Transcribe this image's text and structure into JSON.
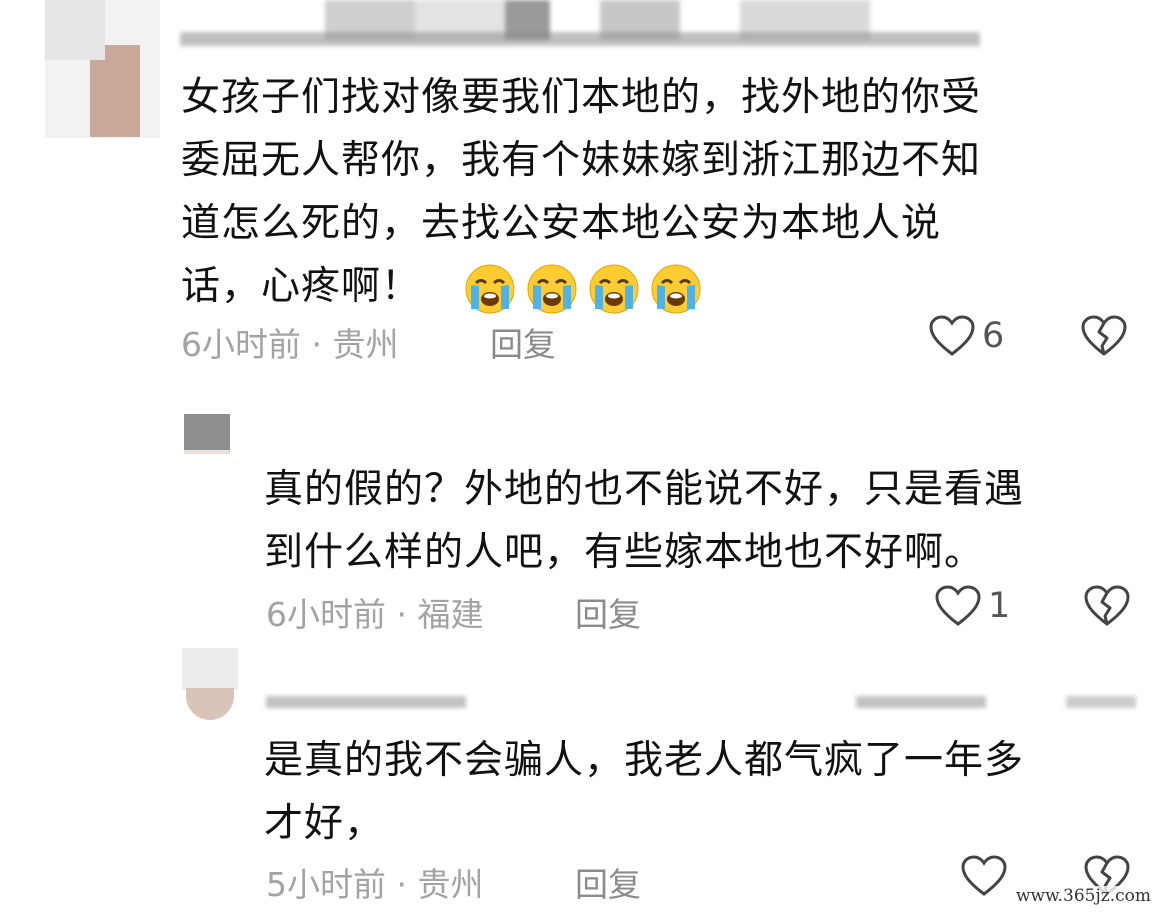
{
  "comments": [
    {
      "text_lines": [
        "女孩子们找对像要我们本地的，找外地的你受",
        "委屈无人帮你，我有个妹妹嫁到浙江那边不知",
        "道怎么死的，去找公安本地公安为本地人说"
      ],
      "last_line_text": "话，心疼啊！",
      "emoji_icon": "loudly-crying-face-icon",
      "emoji_count": 4,
      "meta": "6小时前 · 贵州",
      "reply_label": "回复",
      "like_count": "6"
    },
    {
      "text_lines": [
        "真的假的？外地的也不能说不好，只是看遇",
        "到什么样的人吧，有些嫁本地也不好啊。"
      ],
      "meta": "6小时前 · 福建",
      "reply_label": "回复",
      "like_count": "1"
    },
    {
      "text_lines": [
        "是真的我不会骗人，我老人都气疯了一年多",
        "才好，"
      ],
      "meta": "5小时前 · 贵州",
      "reply_label": "回复",
      "like_count": ""
    }
  ],
  "watermark": "www.365jz.com",
  "colors": {
    "meta": "#a3a3a3",
    "text": "#111111",
    "emoji_face": "#ffcc33",
    "emoji_tears": "#4fb3e8"
  }
}
